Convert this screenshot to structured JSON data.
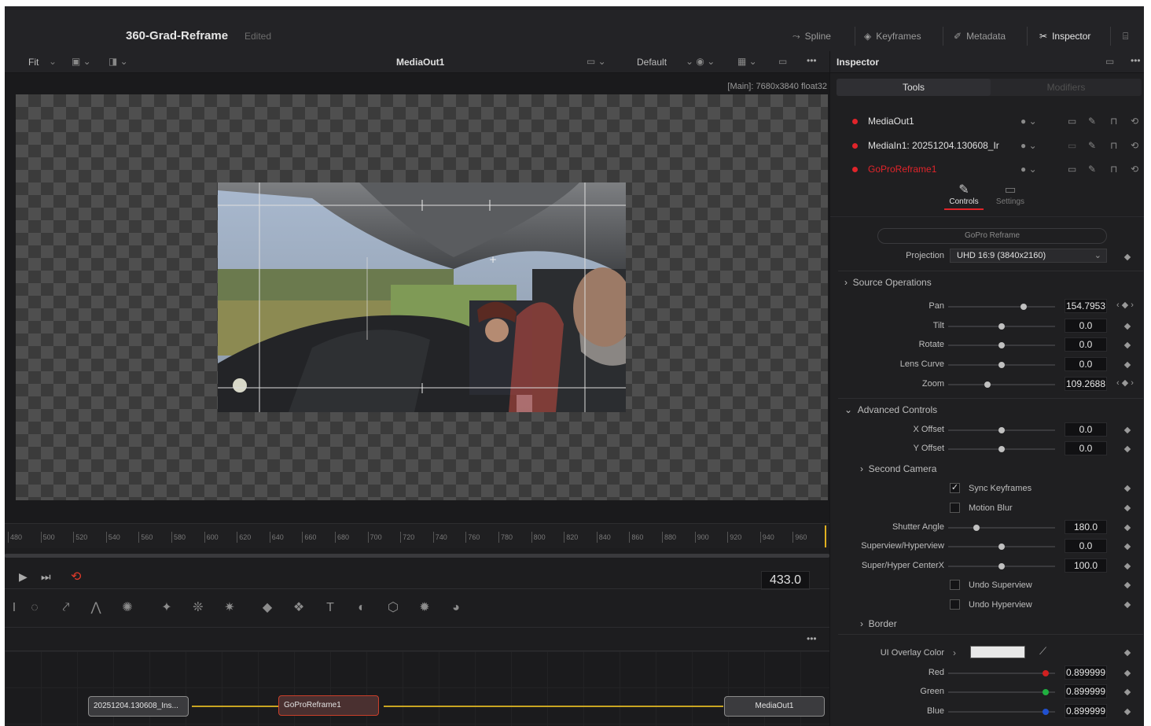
{
  "project": {
    "title": "360-Grad-Reframe",
    "status": "Edited"
  },
  "topbar": {
    "spline": "Spline",
    "keyframes": "Keyframes",
    "metadata": "Metadata",
    "inspector": "Inspector"
  },
  "viewer": {
    "fit": "Fit",
    "name": "MediaOut1",
    "lut": "Default",
    "resolution": "[Main]: 7680x3840 float32"
  },
  "ruler": {
    "ticks": [
      "480",
      "500",
      "520",
      "540",
      "560",
      "580",
      "600",
      "620",
      "640",
      "660",
      "680",
      "700",
      "720",
      "740",
      "760",
      "780",
      "800",
      "820",
      "840",
      "860",
      "880",
      "900",
      "920",
      "940",
      "960"
    ]
  },
  "transport": {
    "frame": "433.0"
  },
  "nodes": {
    "media_in": "20251204.130608_Ins...",
    "reframe": "GoProReframe1",
    "media_out": "MediaOut1"
  },
  "inspector": {
    "title": "Inspector",
    "tabs": {
      "tools": "Tools",
      "modifiers": "Modifiers"
    },
    "tools": [
      {
        "name": "MediaOut1",
        "color": "#e0242a"
      },
      {
        "name": "MediaIn1: 20251204.130608_Ir",
        "color": "#e0242a"
      },
      {
        "name": "GoProReframe1",
        "color": "#e0242a"
      }
    ],
    "subtabs": {
      "controls": "Controls",
      "settings": "Settings"
    },
    "tool_title": "GoPro Reframe",
    "projection": {
      "label": "Projection",
      "value": "UHD 16:9 (3840x2160)"
    },
    "source_ops": "Source Operations",
    "pan": {
      "label": "Pan",
      "value": "154.7953"
    },
    "tilt": {
      "label": "Tilt",
      "value": "0.0"
    },
    "rotate": {
      "label": "Rotate",
      "value": "0.0"
    },
    "lens_curve": {
      "label": "Lens Curve",
      "value": "0.0"
    },
    "zoom": {
      "label": "Zoom",
      "value": "109.2688"
    },
    "advanced": "Advanced Controls",
    "x_offset": {
      "label": "X Offset",
      "value": "0.0"
    },
    "y_offset": {
      "label": "Y Offset",
      "value": "0.0"
    },
    "second_camera": "Second Camera",
    "sync_keyframes": "Sync Keyframes",
    "motion_blur": "Motion Blur",
    "shutter_angle": {
      "label": "Shutter Angle",
      "value": "180.0"
    },
    "superview": {
      "label": "Superview/Hyperview",
      "value": "0.0"
    },
    "super_center": {
      "label": "Super/Hyper CenterX",
      "value": "100.0"
    },
    "undo_superview": "Undo Superview",
    "undo_hyperview": "Undo Hyperview",
    "border": "Border",
    "overlay": {
      "label": "UI Overlay Color",
      "swatch": "#e8e8e8"
    },
    "red": {
      "label": "Red",
      "value": "0.899999",
      "color": "#d02020"
    },
    "green": {
      "label": "Green",
      "value": "0.899999",
      "color": "#20b040"
    },
    "blue": {
      "label": "Blue",
      "value": "0.899999",
      "color": "#2050d0"
    }
  }
}
